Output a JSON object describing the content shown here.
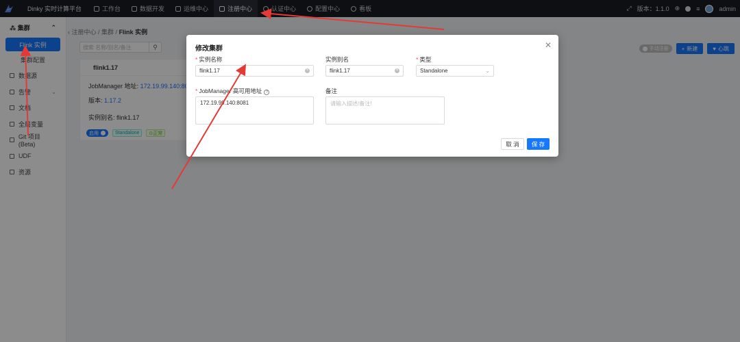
{
  "app": {
    "brand": "Dinky 实时计算平台"
  },
  "nav": [
    {
      "label": "工作台",
      "icon": "home-icon",
      "active": false
    },
    {
      "label": "数据开发",
      "icon": "code-icon",
      "active": false
    },
    {
      "label": "运维中心",
      "icon": "monitor-icon",
      "active": false
    },
    {
      "label": "注册中心",
      "icon": "grid-icon",
      "active": true
    },
    {
      "label": "认证中心",
      "icon": "shield-icon",
      "active": false
    },
    {
      "label": "配置中心",
      "icon": "gear-icon",
      "active": false
    },
    {
      "label": "看板",
      "icon": "dashboard-icon",
      "active": false
    }
  ],
  "top_right": {
    "version": "版本：1.1.0",
    "user": "admin"
  },
  "sidebar": {
    "group": "集群",
    "subitems": [
      "Flink 实例",
      "集群配置"
    ],
    "items": [
      "数据源",
      "告警",
      "文档",
      "全局变量",
      "Git 项目(Beta)",
      "UDF",
      "资源"
    ]
  },
  "main": {
    "breadcrumb": [
      "注册中心",
      "集群",
      "Flink 实例"
    ],
    "search_placeholder": "搜索 名称/别名/备注",
    "auto_register_label": "手动注册",
    "new_label": "新建",
    "heartbeat_label": "心跳",
    "card": {
      "title": "flink1.17",
      "jobmanager_label": "JobManager 地址:",
      "jobmanager_value": "172.19.99.140:8081",
      "version_label": "版本:",
      "version_value": "1.17.2",
      "alias_label": "实例别名:",
      "alias_value": "flink1.17",
      "enabled_label": "启用",
      "type_tag": "Standalone",
      "status_tag": "正常"
    }
  },
  "modal": {
    "title": "修改集群",
    "name_label": "实例名称",
    "name_value": "flink1.17",
    "alias_label": "实例别名",
    "alias_value": "flink1.17",
    "type_label": "类型",
    "type_value": "Standalone",
    "jm_label": "JobManager 高可用地址",
    "jm_value": "172.19.99.140:8081",
    "note_label": "备注",
    "note_placeholder": "请输入描述/备注!",
    "cancel_label": "取 消",
    "save_label": "保 存"
  },
  "colors": {
    "accent": "#1677ff",
    "topbar": "#1b1d24",
    "annotation": "#e53935"
  }
}
